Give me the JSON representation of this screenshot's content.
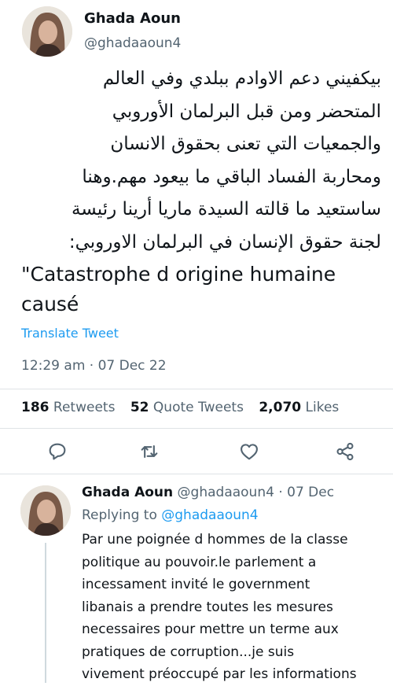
{
  "tweet": {
    "author_name": "Ghada Aoun",
    "author_handle": "@ghadaaoun4",
    "arabic_lines": [
      "بيكفيني دعم الاوادم ببلدي وفي العالم",
      "المتحضر ومن قبل البرلمان الأوروبي",
      "والجمعيات التي تعنى بحقوق الانسان",
      "ومحاربة الفساد الباقي ما بيعود مهم.وهنا",
      "ساستعيد ما قالته السيدة ماريا أرينا رئيسة",
      "لجنة حقوق الإنسان في البرلمان الاوروبي:"
    ],
    "latin_lines": [
      "\"Catastrophe d origine  humaine",
      "causé"
    ],
    "translate_label": "Translate Tweet",
    "timestamp": "12:29 am · 07 Dec 22",
    "stats": {
      "retweets_count": "186",
      "retweets_label": "Retweets",
      "quotes_count": "52",
      "quotes_label": "Quote Tweets",
      "likes_count": "2,070",
      "likes_label": "Likes"
    },
    "actions": [
      "reply-icon",
      "retweet-icon",
      "like-icon",
      "share-icon"
    ]
  },
  "reply": {
    "author_name": "Ghada Aoun",
    "author_handle_time": "@ghadaaoun4 · 07 Dec",
    "replying_prefix": "Replying to",
    "replying_mention": "@ghadaaoun4",
    "lines": [
      "Par une poignée d hommes de la classe",
      "politique au pouvoir.le parlement a",
      "incessament invité le government",
      "libanais a prendre toutes les mesures",
      "necessaires pour mettre un terme aux",
      "pratiques de corruption...je suis",
      "vivement préoccupé par les informations"
    ]
  },
  "colors": {
    "accent": "#1d9bf0",
    "text": "#0f1419",
    "secondary": "#536471",
    "divider": "#dfe3e6"
  }
}
